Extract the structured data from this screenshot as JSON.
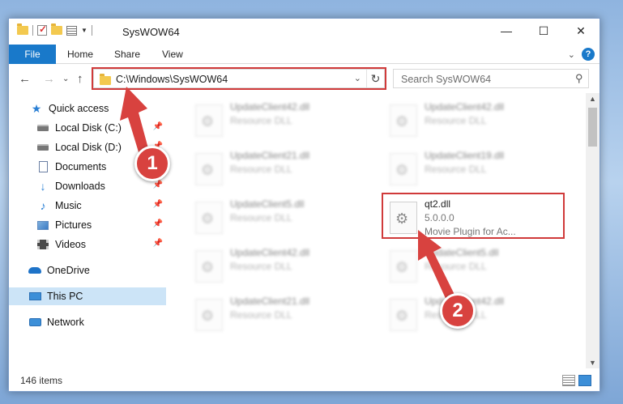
{
  "window": {
    "title": "SysWOW64",
    "controls": {
      "minimize": "—",
      "maximize": "☐",
      "close": "✕"
    }
  },
  "ribbon": {
    "file": "File",
    "tabs": [
      "Home",
      "Share",
      "View"
    ],
    "chevron": "⌄",
    "help": "?"
  },
  "nav": {
    "back": "←",
    "forward": "→",
    "recent": "⌄",
    "up": "↑",
    "address": "C:\\Windows\\SysWOW64",
    "address_dropdown": "⌄",
    "refresh": "↻",
    "search_placeholder": "Search SysWOW64",
    "search_icon": "⚲"
  },
  "sidebar": {
    "items": [
      {
        "label": "Quick access",
        "icon": "star-icon",
        "pinned": false
      },
      {
        "label": "Local Disk (C:)",
        "icon": "drive-icon",
        "pinned": true
      },
      {
        "label": "Local Disk (D:)",
        "icon": "drive-icon",
        "pinned": true
      },
      {
        "label": "Documents",
        "icon": "documents-icon",
        "pinned": true
      },
      {
        "label": "Downloads",
        "icon": "downloads-icon",
        "pinned": true
      },
      {
        "label": "Music",
        "icon": "music-icon",
        "pinned": true
      },
      {
        "label": "Pictures",
        "icon": "pictures-icon",
        "pinned": true
      },
      {
        "label": "Videos",
        "icon": "videos-icon",
        "pinned": true
      },
      {
        "label": "OneDrive",
        "icon": "onedrive-icon",
        "pinned": false
      },
      {
        "label": "This PC",
        "icon": "this-pc-icon",
        "pinned": false,
        "selected": true
      },
      {
        "label": "Network",
        "icon": "network-icon",
        "pinned": false
      }
    ],
    "pin_glyph": "📌"
  },
  "files": [
    {
      "name": "UpdateClient42.dll",
      "type": "Resource DLL",
      "blurred": true
    },
    {
      "name": "UpdateClient42.dll",
      "type": "Resource DLL",
      "blurred": true
    },
    {
      "name": "UpdateClient21.dll",
      "type": "Resource DLL",
      "blurred": true
    },
    {
      "name": "UpdateClient19.dll",
      "type": "Resource DLL",
      "blurred": true
    },
    {
      "name": "UpdateClient5.dll",
      "type": "Resource DLL",
      "blurred": true
    },
    {
      "name": "qt2.dll",
      "type": "5.0.0.0",
      "description": "Movie Plugin for Ac...",
      "blurred": false
    },
    {
      "name": "UpdateClient42.dll",
      "type": "Resource DLL",
      "blurred": true
    },
    {
      "name": "UpdateClient5.dll",
      "type": "Resource DLL",
      "blurred": true
    },
    {
      "name": "UpdateClient21.dll",
      "type": "Resource DLL",
      "blurred": true
    },
    {
      "name": "UpdateClient42.dll",
      "type": "Resource DLL",
      "blurred": true
    }
  ],
  "status": {
    "count": "146 items"
  },
  "annotations": {
    "step1": "1",
    "step2": "2",
    "color": "#d8423f"
  },
  "scroll": {
    "up": "▲",
    "down": "▼"
  }
}
